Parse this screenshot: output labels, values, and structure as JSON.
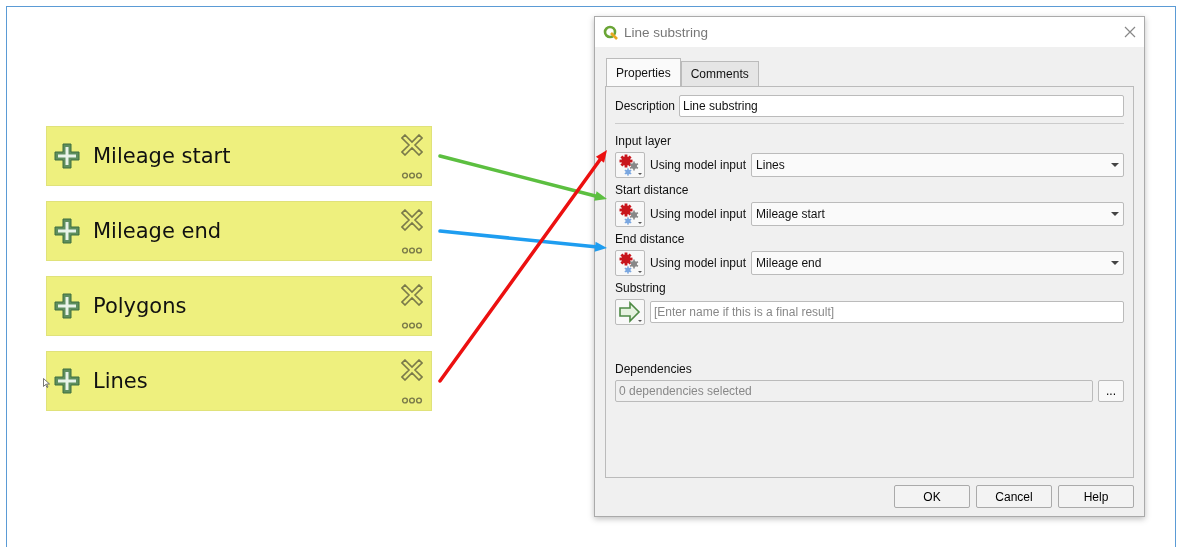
{
  "canvas": {
    "inputs": [
      {
        "label": "Mileage start",
        "color": "#5cbf40"
      },
      {
        "label": "Mileage end",
        "color": "#1e9df0"
      },
      {
        "label": "Polygons"
      },
      {
        "label": "Lines",
        "color": "#ec1010"
      }
    ]
  },
  "dialog": {
    "title": "Line substring",
    "tabs": [
      {
        "label": "Properties",
        "selected": true
      },
      {
        "label": "Comments",
        "selected": false
      }
    ],
    "description": {
      "label": "Description",
      "value": "Line substring"
    },
    "parameters": [
      {
        "label": "Input layer",
        "kind": "model_input",
        "source": "Using model input",
        "value": "Lines",
        "color": "#ec1010"
      },
      {
        "label": "Start distance",
        "kind": "model_input",
        "source": "Using model input",
        "value": "Mileage start",
        "color": "#5cbf40"
      },
      {
        "label": "End distance",
        "kind": "model_input",
        "source": "Using model input",
        "value": "Mileage end",
        "color": "#1e9df0"
      },
      {
        "label": "Substring",
        "kind": "output",
        "placeholder": "[Enter name if this is a final result]"
      }
    ],
    "dependencies": {
      "label": "Dependencies",
      "value": "0 dependencies selected",
      "button": "..."
    },
    "buttons": [
      "OK",
      "Cancel",
      "Help"
    ]
  }
}
